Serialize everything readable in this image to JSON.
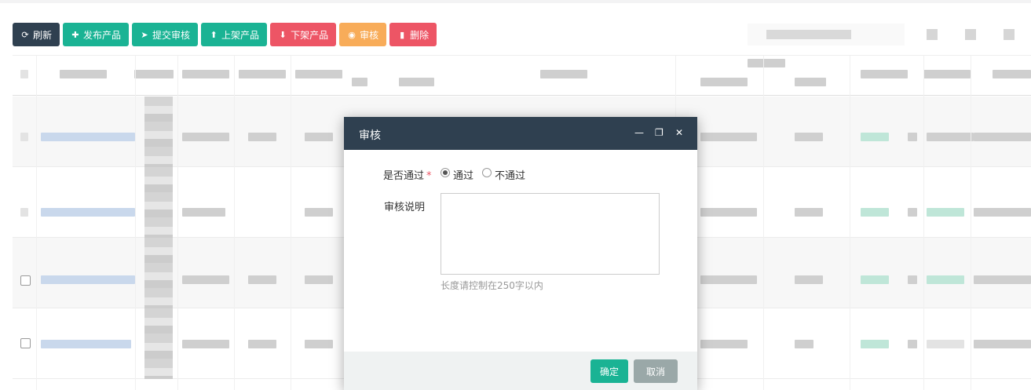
{
  "toolbar": {
    "buttons": [
      {
        "label": "刷新",
        "icon": "refresh-icon",
        "glyph": "⟳"
      },
      {
        "label": "发布产品",
        "icon": "plus-icon",
        "glyph": "✚"
      },
      {
        "label": "提交审核",
        "icon": "paper-plane-icon",
        "glyph": "➤"
      },
      {
        "label": "上架产品",
        "icon": "upload-icon",
        "glyph": "⬆"
      },
      {
        "label": "下架产品",
        "icon": "download-icon",
        "glyph": "⬇"
      },
      {
        "label": "审核",
        "icon": "eye-icon",
        "glyph": "◉"
      },
      {
        "label": "删除",
        "icon": "trash-icon",
        "glyph": "▮"
      }
    ]
  },
  "colors": {
    "dark": "#2f4050",
    "teal": "#1ab394",
    "red": "#ed5565",
    "orange": "#f8ac59",
    "footer": "#eff2f2",
    "cancel": "#9aa8a8",
    "confirm": "#1ab394"
  },
  "dialog": {
    "title": "审核",
    "controls": {
      "minimize": "—",
      "maximize": "❐",
      "close": "✕"
    },
    "pass_label": "是否通过",
    "required_mark": "*",
    "options": [
      {
        "label": "通过",
        "checked": true
      },
      {
        "label": "不通过",
        "checked": false
      }
    ],
    "note_label": "审核说明",
    "note_value": "",
    "note_hint": "长度请控制在250字以内",
    "confirm_label": "确定",
    "cancel_label": "取消"
  }
}
